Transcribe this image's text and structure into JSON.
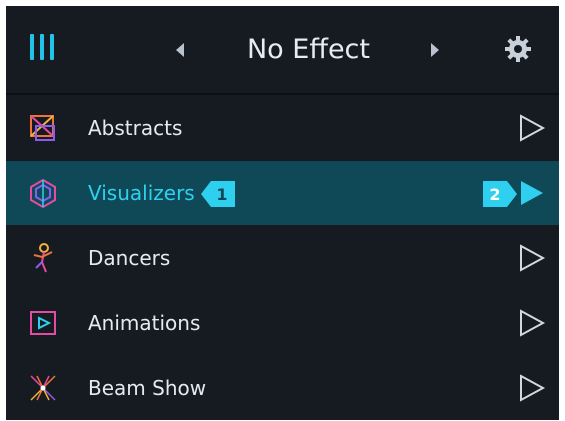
{
  "header": {
    "title": "No Effect",
    "menu_icon": "menu-bars-icon",
    "prev_icon": "left-arrow-icon",
    "next_icon": "right-arrow-icon",
    "settings_icon": "gear-icon"
  },
  "menu": {
    "items": [
      {
        "label": "Abstracts",
        "icon": "abstracts-icon",
        "active": false
      },
      {
        "label": "Visualizers",
        "icon": "visualizers-icon",
        "active": true,
        "badge_left": "1",
        "badge_right": "2"
      },
      {
        "label": "Dancers",
        "icon": "dancers-icon",
        "active": false
      },
      {
        "label": "Animations",
        "icon": "animations-icon",
        "active": false
      },
      {
        "label": "Beam Show",
        "icon": "beam-show-icon",
        "active": false
      }
    ]
  },
  "colors": {
    "background": "#161b22",
    "accent": "#22c3e6",
    "active_row": "#0f4957",
    "text": "#e6eaef"
  }
}
